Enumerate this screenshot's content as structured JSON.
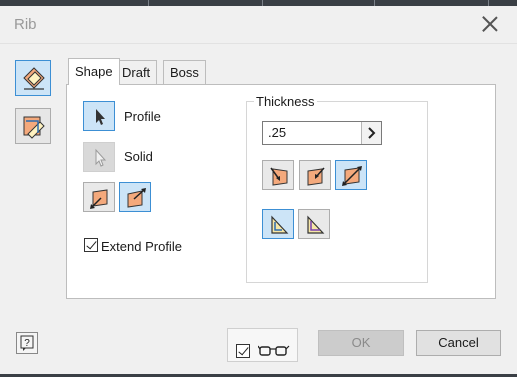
{
  "dialog": {
    "title": "Rib"
  },
  "tabs": [
    {
      "label": "Shape",
      "active": true
    },
    {
      "label": "Draft",
      "active": false
    },
    {
      "label": "Boss",
      "active": false
    }
  ],
  "shape": {
    "profile_label": "Profile",
    "solid_label": "Solid",
    "extend_profile": {
      "label": "Extend Profile",
      "checked": true
    }
  },
  "thickness": {
    "group_label": "Thickness",
    "value": ".25"
  },
  "footer": {
    "ok_label": "OK",
    "cancel_label": "Cancel",
    "preview_checked": true
  },
  "colors": {
    "accent": "#3c8fd4",
    "selected_fill": "#cce4f7",
    "rib_orange": "#f4a97c"
  },
  "icons": {
    "help": "question-mark",
    "preview": "eyeglasses",
    "close": "x"
  }
}
